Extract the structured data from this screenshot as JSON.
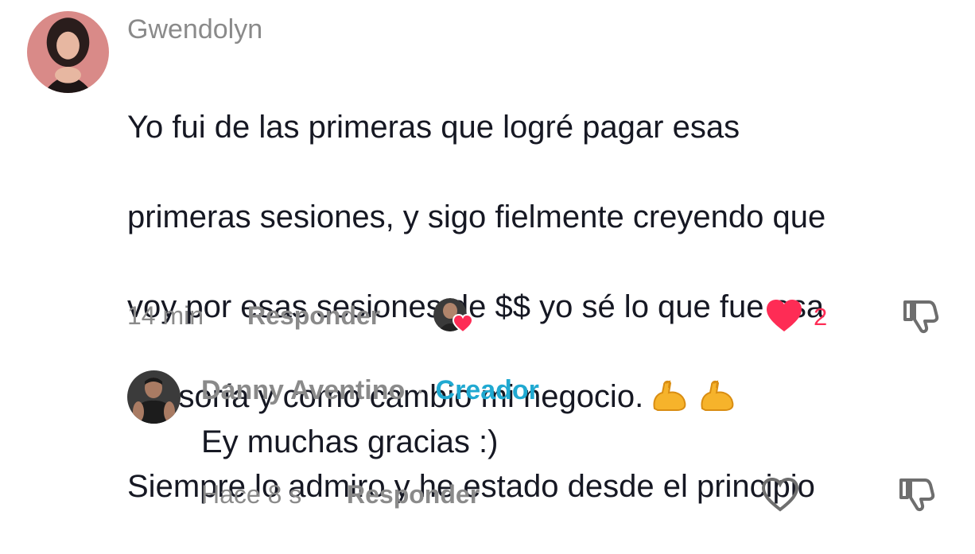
{
  "comment": {
    "author": "Gwendolyn",
    "lines": [
      "Yo fui de las primeras que logré pagar esas",
      "primeras sesiones, y sigo fielmente creyendo que",
      "voy por esas sesiones de $$ yo sé lo que fue esa",
      "asesoría y como cambio mi negocio.",
      "Siempre lo admiro y he estado desde el principio"
    ],
    "emojis": [
      "flexed-biceps-icon",
      "flexed-biceps-icon"
    ],
    "time": "14 min",
    "reply_label": "Responder",
    "like_count": "2",
    "liked_by_creator": true,
    "liked": true
  },
  "reply": {
    "author": "Danny Aventino",
    "separator": "·",
    "badge": "Creador",
    "text": "Ey muchas gracias :)",
    "time": "Hace 8 s",
    "reply_label": "Responder",
    "liked": false
  },
  "colors": {
    "like_red": "#fe2c55",
    "creator_blue": "#20a9d1",
    "muted_gray": "#8a8a8a",
    "text": "#161823"
  }
}
